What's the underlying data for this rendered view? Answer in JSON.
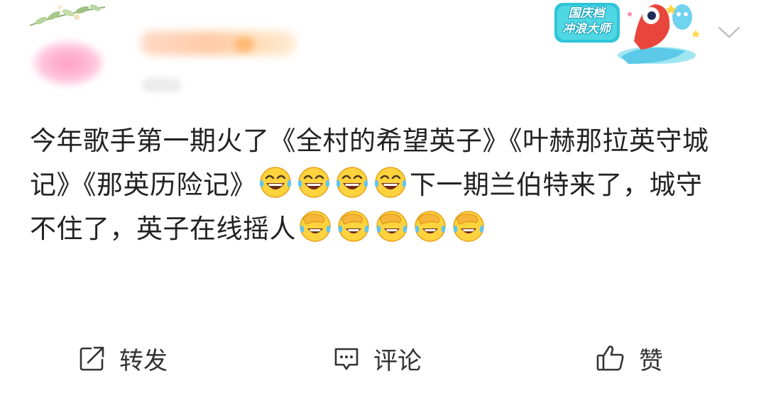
{
  "header": {
    "badge_text_line1": "国庆档",
    "badge_text_line2": "冲浪大师"
  },
  "post": {
    "text_segments": [
      "今年歌手第一期火了《全村的希望英子》《叶赫那拉英守城记》《那英历险记》",
      "下一期兰伯特来了，城守不住了，英子在线摇人"
    ],
    "emojis_after_segment_1": [
      "laughing-tears-emoji",
      "laughing-tears-emoji",
      "laughing-tears-emoji",
      "laughing-tears-emoji"
    ],
    "emojis_after_segment_2": [
      "facepalm-cry-emoji",
      "facepalm-cry-emoji",
      "facepalm-cry-emoji",
      "facepalm-cry-emoji",
      "facepalm-cry-emoji"
    ]
  },
  "actions": {
    "repost_label": "转发",
    "comment_label": "评论",
    "like_label": "赞"
  },
  "icons": {
    "repost": "share-icon",
    "comment": "comment-icon",
    "like": "thumbs-up-icon",
    "more": "chevron-down-icon"
  }
}
